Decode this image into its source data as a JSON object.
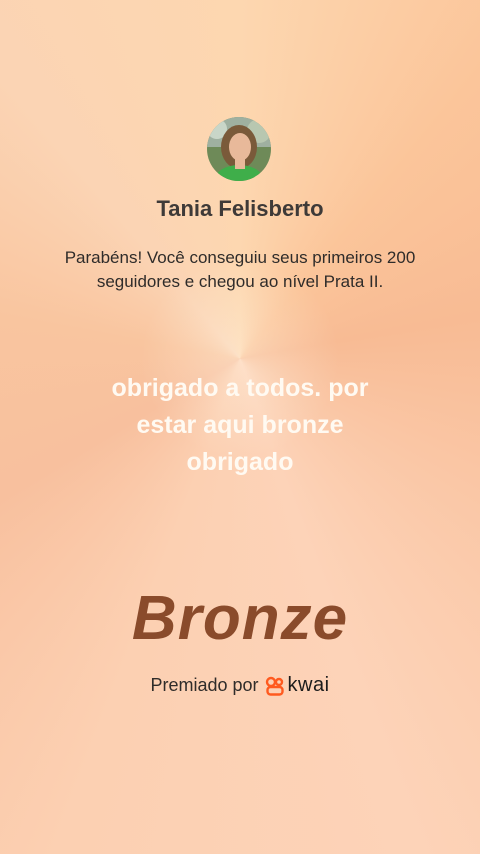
{
  "profile": {
    "name": "Tania Felisberto"
  },
  "achievement": {
    "message": "Parabéns! Você conseguiu seus primeiros 200 seguidores e chegou ao nível Prata II.",
    "post_text": "obrigado a todos. por estar aqui bronze obrigado",
    "level": "Bronze"
  },
  "footer": {
    "awarded_label": "Premiado por",
    "brand": "kwai",
    "brand_icon": "kwai-logo-icon"
  },
  "colors": {
    "level_text": "#8a4b2b",
    "brand_orange": "#ff5a1f",
    "post_text": "#fffaf2"
  }
}
